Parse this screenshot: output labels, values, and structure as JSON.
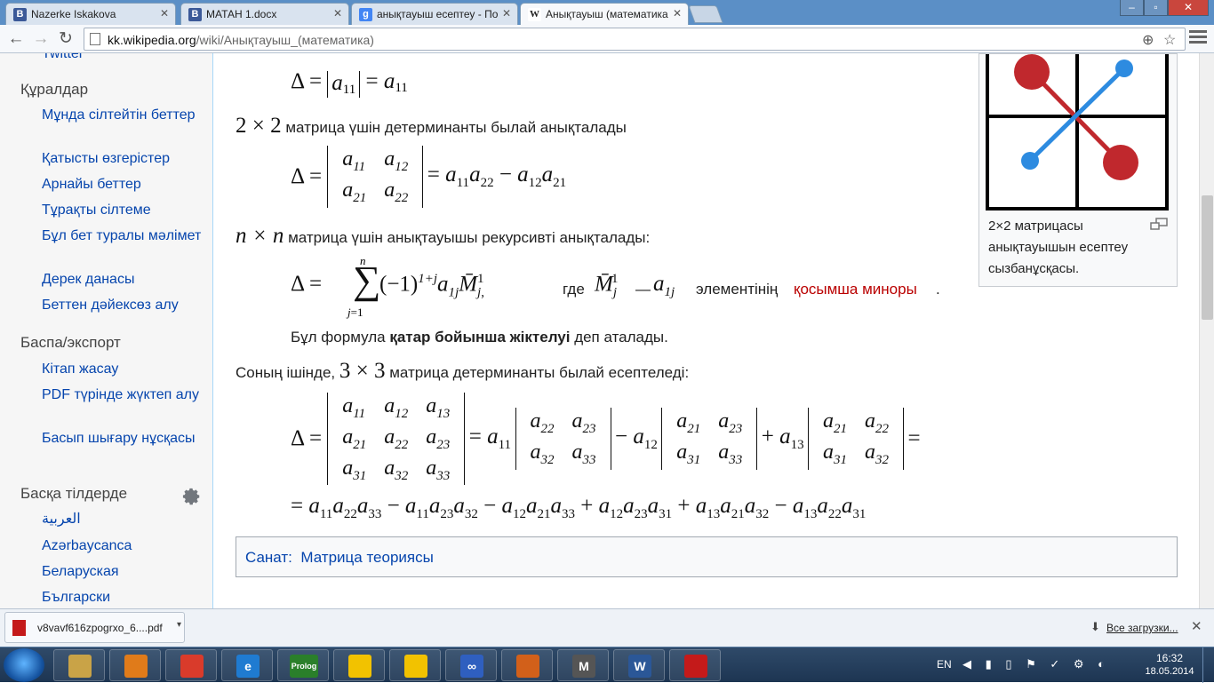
{
  "tabs": [
    {
      "label": "Nazerke Iskakova",
      "favicon": "B",
      "color": "#3b5998"
    },
    {
      "label": "МАТАН 1.docx",
      "favicon": "B",
      "color": "#3b5998"
    },
    {
      "label": "анықтауыш есептеу - По",
      "favicon": "g",
      "color": "#4285f4"
    },
    {
      "label": "Анықтауыш (математика",
      "favicon": "W",
      "color": "#333333"
    }
  ],
  "url": {
    "host": "kk.wikipedia.org",
    "path": "/wiki/Анықтауыш_(математика)"
  },
  "sidebar": {
    "partial_top": "Twitter",
    "sections": [
      {
        "heading": "Құралдар",
        "items": [
          "Мұнда сілтейтін беттер",
          "Қатысты өзгерістер",
          "Арнайы беттер",
          "Тұрақты сілтеме",
          "Бұл бет туралы мәлімет",
          "Дерек данасы",
          "Беттен дәйексөз алу"
        ]
      },
      {
        "heading": "Баспа/экспорт",
        "items": [
          "Кітап жасау",
          "PDF түрінде жүктеп алу",
          "Басып шығару нұсқасы"
        ]
      },
      {
        "heading": "Басқа тілдерде",
        "items": [
          "العربية",
          "Azərbaycanca",
          "Беларуская",
          "Български"
        ]
      }
    ]
  },
  "content": {
    "size_2x2": "2 × 2",
    "text_2x2": "матрица үшін детерминанты былай анықталады",
    "size_nxn": "n × n",
    "text_nxn": "матрица үшін анықтауышы рекурсивті анықталады:",
    "where": "где",
    "minor_text_1": "— ",
    "minor_text_2": "элементінің",
    "minor_link": "қосымша миноры",
    "period": ".",
    "formula_intro": "Бұл формула",
    "formula_bold": "қатар бойынша жіктелуі",
    "formula_outro": "деп аталады.",
    "intro_3x3": "Соның ішінде,",
    "size_3x3": "3 × 3",
    "text_3x3": "матрица детерминанты былай есептеледі:"
  },
  "infobox": {
    "caption": "2×2 матрицасы анықтауышын есептеу сызбанұсқасы.",
    "line_red": "#c0282d",
    "line_blue": "#2d8be0"
  },
  "category": {
    "label": "Санат:",
    "link": "Матрица теориясы"
  },
  "download": {
    "filename": "v8vavf616zpogrxo_6....pdf",
    "show_all": "Все загрузки..."
  },
  "taskbar": {
    "lang": "EN",
    "time": "16:32",
    "date": "18.05.2014",
    "apps": [
      {
        "label": "",
        "color": "#c9a347"
      },
      {
        "label": "",
        "color": "#e07b1a"
      },
      {
        "label": "",
        "color": "#d93b2b"
      },
      {
        "label": "e",
        "color": "#1f7bd1"
      },
      {
        "label": "Prolog",
        "color": "#2a7f2a"
      },
      {
        "label": "",
        "color": "#f2c200"
      },
      {
        "label": "",
        "color": "#f2c200"
      },
      {
        "label": "∞",
        "color": "#2f5fbf"
      },
      {
        "label": "",
        "color": "#d2601a"
      },
      {
        "label": "M",
        "color": "#555555"
      },
      {
        "label": "W",
        "color": "#2b5797"
      },
      {
        "label": "",
        "color": "#c41a1a"
      }
    ]
  }
}
